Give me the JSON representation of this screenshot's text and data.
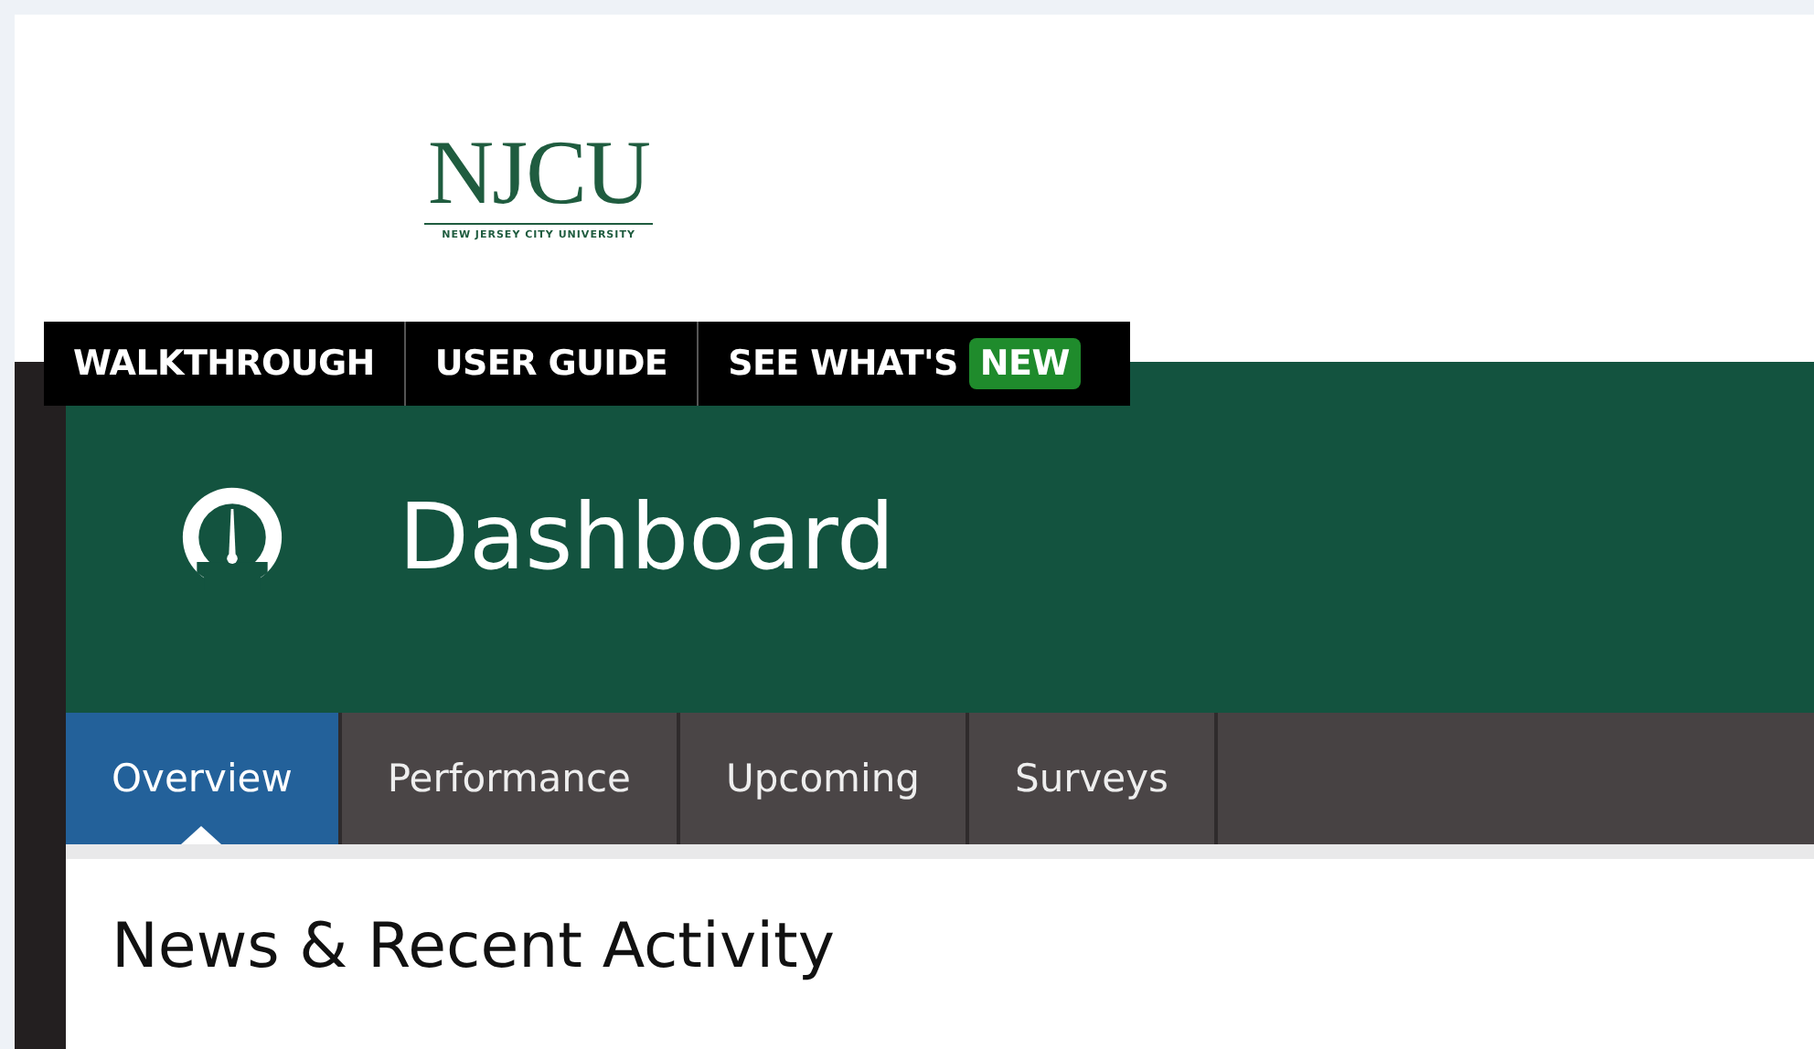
{
  "logo": {
    "wordmark": "NJCU",
    "tagline": "NEW JERSEY CITY UNIVERSITY"
  },
  "top_nav": [
    {
      "label": "WALKTHROUGH"
    },
    {
      "label": "USER GUIDE"
    },
    {
      "label": "SEE WHAT'S",
      "badge": "NEW"
    }
  ],
  "header": {
    "title": "Dashboard"
  },
  "tabs": [
    {
      "label": "Overview",
      "selected": true
    },
    {
      "label": "Performance",
      "selected": false
    },
    {
      "label": "Upcoming",
      "selected": false
    },
    {
      "label": "Surveys",
      "selected": false
    }
  ],
  "section": {
    "heading": "News & Recent Activity"
  }
}
